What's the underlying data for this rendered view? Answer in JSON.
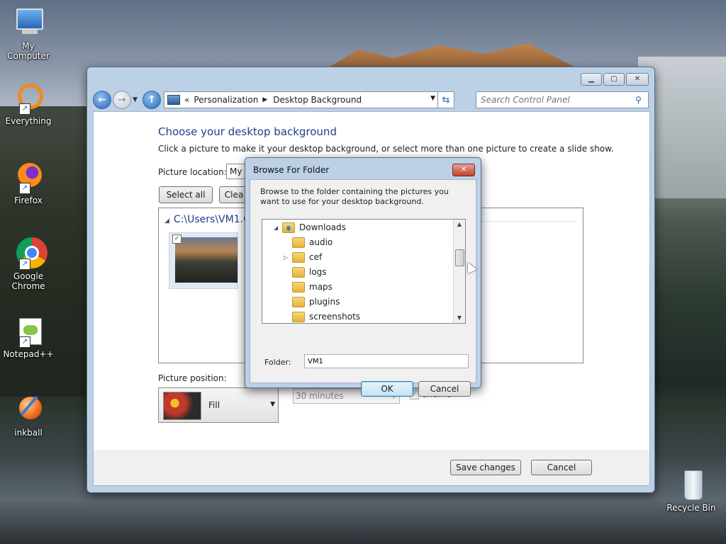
{
  "desktop": {
    "icons": [
      {
        "label": "My Computer"
      },
      {
        "label": "Everything"
      },
      {
        "label": "Firefox"
      },
      {
        "label": "Google Chrome"
      },
      {
        "label": "Notepad++"
      },
      {
        "label": "inkball"
      },
      {
        "label": "Recycle Bin"
      }
    ]
  },
  "window": {
    "address": {
      "root_sep": "«",
      "crumb1": "Personalization",
      "crumb2": "Desktop Background"
    },
    "search_placeholder": "Search Control Panel",
    "heading": "Choose your desktop background",
    "subtext": "Click a picture to make it your desktop background, or select more than one picture to create a slide show.",
    "picture_location_label": "Picture location:",
    "picture_location_value": "My P",
    "select_all": "Select all",
    "clear_all": "Clea",
    "folder_path": "C:\\Users\\VM1.C",
    "picture_position_label": "Picture position:",
    "picture_position_value": "Fill",
    "interval_value": "30 minutes",
    "shuffle_label": "Shuffle",
    "save_changes": "Save changes",
    "cancel": "Cancel"
  },
  "dialog": {
    "title": "Browse For Folder",
    "description": "Browse to the folder containing the pictures you want to use for your desktop background.",
    "tree": [
      {
        "label": "Downloads"
      },
      {
        "label": "audio"
      },
      {
        "label": "cef"
      },
      {
        "label": "logs"
      },
      {
        "label": "maps"
      },
      {
        "label": "plugins"
      },
      {
        "label": "screenshots"
      }
    ],
    "folder_label": "Folder:",
    "folder_value": "VM1",
    "ok": "OK",
    "cancel": "Cancel"
  }
}
